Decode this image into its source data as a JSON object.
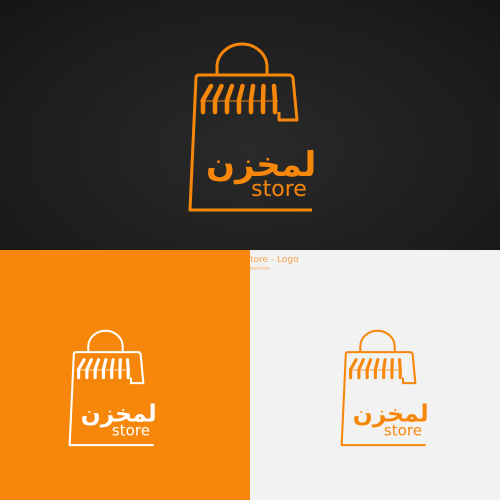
{
  "brand": {
    "arabic_name": "المخزن",
    "latin_name": "store"
  },
  "caption": {
    "title": "tore - Logo",
    "subtitle": "berrimo"
  },
  "colors": {
    "brand_orange": "#f7870b",
    "dark_bg": "#1e1e1e",
    "light_bg": "#f2f2f2",
    "white": "#ffffff"
  }
}
